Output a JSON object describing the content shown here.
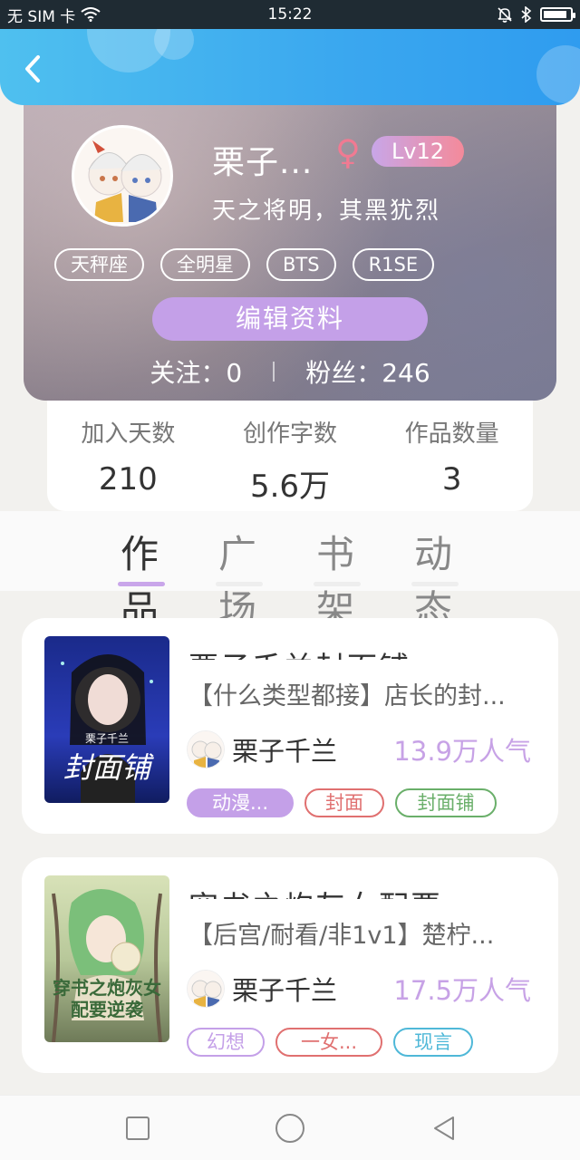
{
  "status_bar": {
    "carrier": "无 SIM 卡",
    "time": "15:22",
    "battery_level": 0.9
  },
  "profile": {
    "name": "栗子...",
    "gender_symbol": "♀",
    "level": "Lv12",
    "motto": "天之将明，其黑犹烈",
    "tags": [
      "天秤座",
      "全明星",
      "BTS",
      "R1SE"
    ],
    "edit_label": "编辑资料",
    "following_label": "关注：0",
    "fans_label": "粉丝：246"
  },
  "stats": [
    {
      "label": "加入天数",
      "value": "210"
    },
    {
      "label": "创作字数",
      "value": "5.6万"
    },
    {
      "label": "作品数量",
      "value": "3"
    }
  ],
  "tabs": [
    "作品",
    "广场",
    "书架",
    "动态"
  ],
  "active_tab": 0,
  "books": [
    {
      "title": "栗子千兰封面铺",
      "desc": "【什么类型都接】店长的封...",
      "cover_text_small": "栗子千兰",
      "cover_text_big": "封面铺",
      "author": "栗子千兰",
      "popularity": "13.9万人气",
      "tags": [
        {
          "label": "动漫...",
          "style": "filled",
          "color": "#c4a0e8"
        },
        {
          "label": "封面",
          "style": "outline",
          "color": "#e07070"
        },
        {
          "label": "封面铺",
          "style": "outline",
          "color": "#6aaf6a"
        }
      ]
    },
    {
      "title": "穿书之炮灰女配要",
      "desc": "【后宫/耐看/非1v1】楚柠...",
      "cover_text_small": "",
      "cover_text_big": "穿书之炮灰女配要逆袭",
      "author": "栗子千兰",
      "popularity": "17.5万人气",
      "tags": [
        {
          "label": "幻想",
          "style": "outline",
          "color": "#c4a0e8"
        },
        {
          "label": "一女...",
          "style": "outline",
          "color": "#e07070"
        },
        {
          "label": "现言",
          "style": "outline",
          "color": "#4fb8d8"
        }
      ]
    }
  ],
  "icons": {
    "back": "chevron-left-icon",
    "wifi": "wifi-icon",
    "mute": "bell-off-icon",
    "bluetooth": "bluetooth-icon",
    "battery": "battery-icon",
    "nav_recent": "square-icon",
    "nav_home": "circle-icon",
    "nav_back": "triangle-back-icon"
  }
}
